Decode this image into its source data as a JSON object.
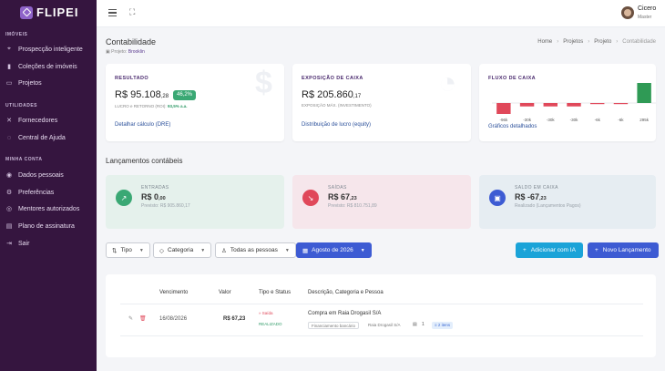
{
  "app": {
    "logo_text": "FLIPEI"
  },
  "sidebar": {
    "sections": [
      {
        "title": "IMÓVEIS",
        "items": [
          {
            "label": "Prospecção inteligente",
            "icon": "pin-icon"
          },
          {
            "label": "Coleções de imóveis",
            "icon": "bookmark-icon"
          },
          {
            "label": "Projetos",
            "icon": "folder-icon"
          }
        ]
      },
      {
        "title": "UTILIDADES",
        "items": [
          {
            "label": "Fornecedores",
            "icon": "tools-icon"
          },
          {
            "label": "Central de Ajuda",
            "icon": "help-icon"
          }
        ]
      },
      {
        "title": "MINHA CONTA",
        "items": [
          {
            "label": "Dados pessoais",
            "icon": "user-icon"
          },
          {
            "label": "Preferências",
            "icon": "gear-icon"
          },
          {
            "label": "Mentores autorizados",
            "icon": "users-icon"
          },
          {
            "label": "Plano de assinatura",
            "icon": "card-icon"
          },
          {
            "label": "Sair",
            "icon": "logout-icon"
          }
        ]
      }
    ]
  },
  "topbar": {
    "user_name": "Cicero",
    "user_role": "Master"
  },
  "header": {
    "title": "Contabilidade",
    "project_prefix": "Projeto:",
    "project_name": "Brooklin",
    "breadcrumb": [
      "Home",
      "Projetos",
      "Projeto",
      "Contabilidade"
    ]
  },
  "cards": {
    "resultado": {
      "label": "RESULTADO",
      "value": "R$ 95.108",
      "value_cents": ",28",
      "badge": "46,2%",
      "sub_prefix": "LUCRO e RETORNO (ROI):",
      "sub_value": "93,5% a.a.",
      "link": "Detalhar cálculo (DRE)"
    },
    "exposicao": {
      "label": "EXPOSIÇÃO DE CAIXA",
      "value": "R$ 205.860",
      "value_cents": ",17",
      "sub": "EXPOSIÇÃO MÁX. (INVESTIMENTO)",
      "link": "Distribuição de lucro (equity)"
    },
    "fluxo": {
      "label": "FLUXO DE CAIXA",
      "link": "Gráficos detalhados"
    }
  },
  "chart_data": {
    "type": "bar",
    "categories": [
      "",
      "",
      "",
      "",
      "",
      "",
      ""
    ],
    "values": [
      -96,
      -30,
      -30,
      -30,
      -6,
      -6,
      295
    ],
    "data_labels": [
      "-96k",
      "-30k",
      "-30k",
      "-30k",
      "-6k",
      "-6k",
      "295k"
    ],
    "colors": {
      "negative": "#e0485a",
      "positive": "#2f9a55"
    }
  },
  "lancamentos": {
    "title": "Lançamentos contábeis",
    "entradas": {
      "label": "ENTRADAS",
      "value": "R$ 0",
      "cents": ",00",
      "sub": "Previsto: R$ 905.860,17"
    },
    "saidas": {
      "label": "SAÍDAS",
      "value": "R$ 67",
      "cents": ",23",
      "sub": "Previsto: R$ 810.751,89"
    },
    "saldo": {
      "label": "SALDO EM CAIXA",
      "value": "R$ -67",
      "cents": ",23",
      "sub": "Realizado (Lançamentos Pagos)"
    }
  },
  "filters": {
    "tipo": "Tipo",
    "categoria": "Categoria",
    "pessoas": "Todas as pessoas",
    "mes": "Agosto de 2026",
    "add_ia": "Adicionar com IA",
    "novo": "Novo Lançamento"
  },
  "table": {
    "headers": [
      "Vencimento",
      "Valor",
      "Tipo e Status",
      "Descrição, Categoria e Pessoa"
    ],
    "rows": [
      {
        "vencimento": "16/08/2026",
        "valor": "R$ 67,23",
        "tipo": "» Saída",
        "status": "REALIZADO",
        "descricao": "Compra em Raia Drogasil S/A",
        "categoria": "Financiamento bancário",
        "pessoa": "Raia Drogasil S/A",
        "anexos": "1",
        "itens": "2 itens"
      }
    ]
  },
  "colors": {
    "sidebar_bg": "#35153f",
    "primary": "#3d5bd3",
    "ia_button": "#1aa3d8",
    "positive": "#3aa874",
    "negative": "#e0485a"
  }
}
